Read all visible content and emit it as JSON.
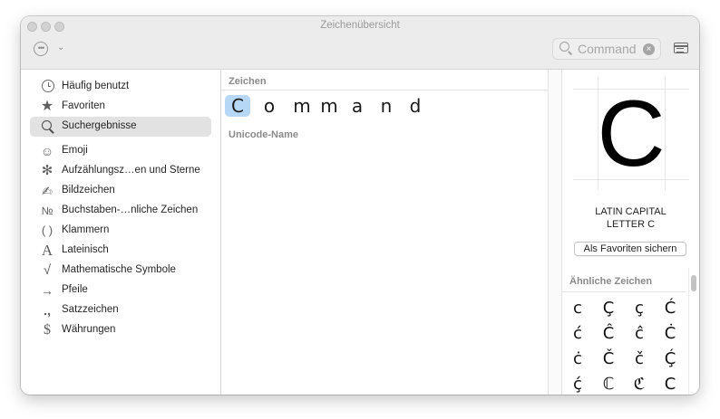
{
  "window": {
    "title": "Zeichenübersicht"
  },
  "toolbar": {
    "action_icon": "ellipsis-circle-icon",
    "search": {
      "value": "Command",
      "icon": "search-icon",
      "clear_icon": "clear-icon"
    },
    "sidebar_toggle_icon": "inspector-toggle-icon"
  },
  "sidebar": {
    "items": [
      {
        "label": "Häufig benutzt",
        "icon": "clock-icon"
      },
      {
        "label": "Favoriten",
        "icon": "star-icon"
      },
      {
        "label": "Suchergebnisse",
        "icon": "search-icon",
        "selected": true
      },
      {
        "label": "Emoji",
        "icon": "smiley-icon"
      },
      {
        "label": "Aufzählungsz…en und Sterne",
        "icon": "asterisk-icon"
      },
      {
        "label": "Bildzeichen",
        "icon": "pen-icon"
      },
      {
        "label": "Buchstaben-…nliche Zeichen",
        "icon": "numero-icon"
      },
      {
        "label": "Klammern",
        "icon": "parentheses-icon"
      },
      {
        "label": "Lateinisch",
        "icon": "latin-a-icon"
      },
      {
        "label": "Mathematische Symbole",
        "icon": "sqrt-icon"
      },
      {
        "label": "Pfeile",
        "icon": "arrow-icon"
      },
      {
        "label": "Satzzeichen",
        "icon": "punctuation-icon"
      },
      {
        "label": "Währungen",
        "icon": "dollar-icon"
      }
    ]
  },
  "main": {
    "chars_header": "Zeichen",
    "unicode_header": "Unicode-Name",
    "glyphs": [
      "C",
      "o",
      "m",
      "m",
      "a",
      "n",
      "d"
    ],
    "selected_index": 0
  },
  "inspector": {
    "glyph": "C",
    "name_line1": "LATIN CAPITAL",
    "name_line2": "LETTER C",
    "fav_button": "Als Favoriten sichern",
    "related_header": "Ähnliche Zeichen",
    "related": [
      "c",
      "Ç",
      "ç",
      "Ć",
      "ć",
      "Ĉ",
      "ĉ",
      "Ċ",
      "ċ",
      "Č",
      "č",
      "Ḉ",
      "ḉ",
      "ℂ",
      "ℭ",
      "Ⅽ"
    ]
  },
  "colors": {
    "selection": "#b7d7f7",
    "sidebar_selected": "#e2e2e2"
  }
}
